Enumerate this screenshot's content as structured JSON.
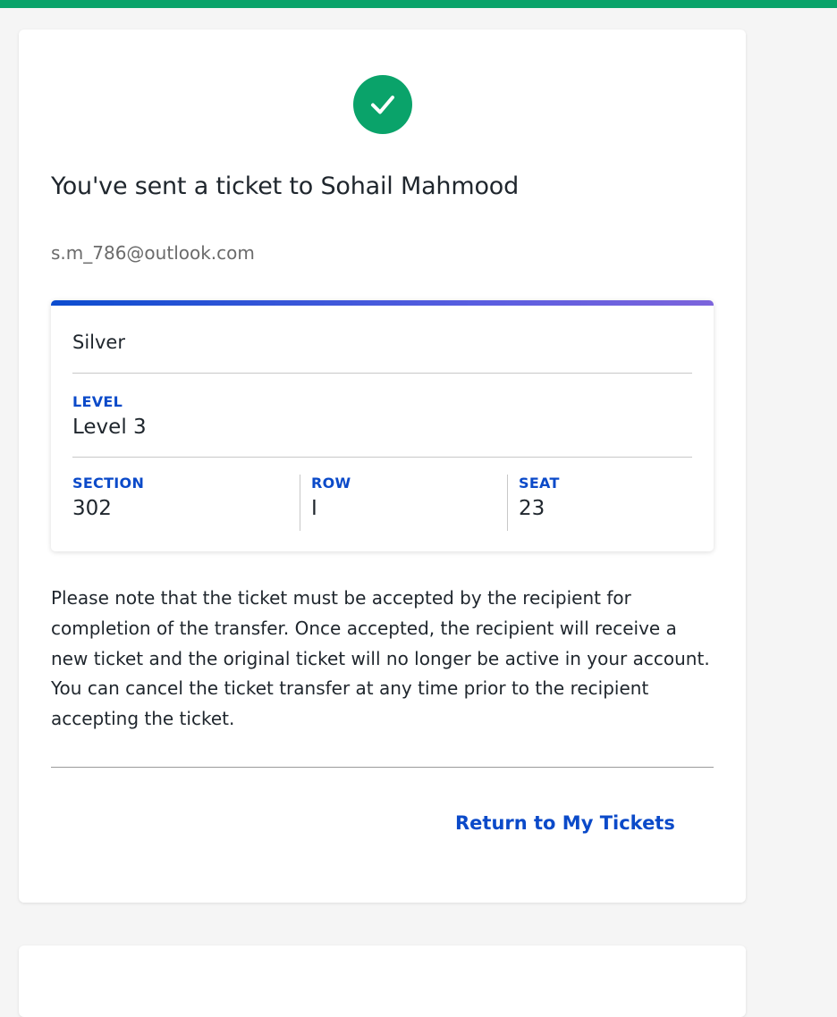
{
  "colors": {
    "accent_green": "#0aa36a",
    "link_blue": "#0b4ac9"
  },
  "confirmation": {
    "icon": "check-circle-icon",
    "title": "You've sent a ticket to Sohail Mahmood",
    "email": "s.m_786@outlook.com"
  },
  "ticket": {
    "type": "Silver",
    "level_label": "LEVEL",
    "level_value": "Level 3",
    "section_label": "SECTION",
    "section_value": "302",
    "row_label": "ROW",
    "row_value": "I",
    "seat_label": "SEAT",
    "seat_value": "23"
  },
  "note": "Please note that the ticket must be accepted by the recipient for completion of the transfer. Once accepted, the recipient will receive a new ticket and the original ticket will no longer be active in your account. You can cancel the ticket transfer at any time prior to the recipient accepting the ticket.",
  "actions": {
    "return_label": "Return to My Tickets"
  }
}
